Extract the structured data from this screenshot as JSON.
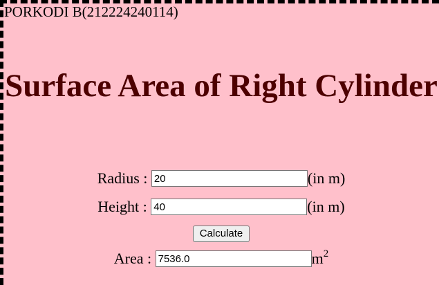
{
  "author": "PORKODI B(212224240114)",
  "title": "Surface Area of Right Cylinder",
  "radius": {
    "label": "Radius :",
    "value": "20",
    "unit": "(in m)"
  },
  "height": {
    "label": "Height :",
    "value": "40",
    "unit": "(in m)"
  },
  "calculate_label": "Calculate",
  "area": {
    "label": "Area :",
    "value": "7536.0",
    "unit": "m",
    "unit_exponent": "2"
  },
  "colors": {
    "background": "#ffc0cb",
    "title": "#4d0000",
    "border": "#000000"
  }
}
